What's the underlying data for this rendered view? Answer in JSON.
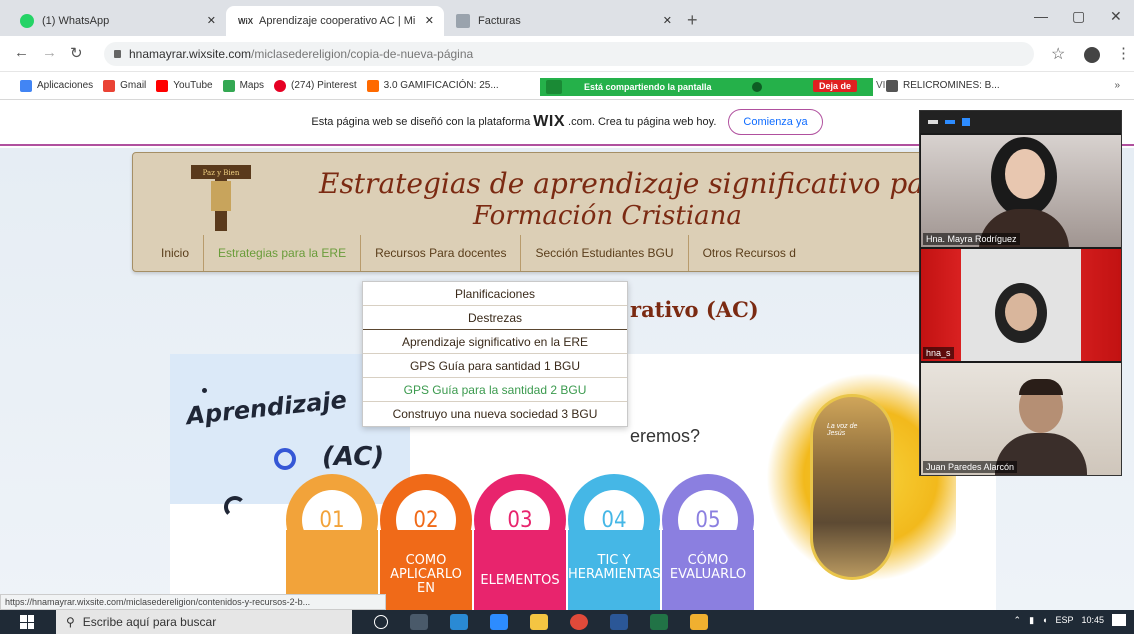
{
  "browser": {
    "tabs": [
      {
        "label": "(1) WhatsApp",
        "favicon_color": "#25d366"
      },
      {
        "label": "Aprendizaje cooperativo AC | Mi",
        "favicon_text": "WiX"
      },
      {
        "label": "Facturas"
      }
    ],
    "new_tab": "+",
    "url_host": "hnamayrar.wixsite.com",
    "url_path": "/miclasedereligion/copia-de-nueva-página",
    "bookmarks": [
      {
        "label": "Aplicaciones",
        "color": "#4285f4"
      },
      {
        "label": "Gmail",
        "color": "#ea4335"
      },
      {
        "label": "YouTube",
        "color": "#ff0000"
      },
      {
        "label": "Maps",
        "color": "#34a853"
      },
      {
        "label": "(274) Pinterest",
        "color": "#e60023"
      },
      {
        "label": "3.0 GAMIFICACIÓN: 25...",
        "color": "#ff6a00"
      }
    ],
    "bookmark_tail": "RELICROMINES: B...",
    "share_text": "Está compartiendo la pantalla",
    "share_stop": "Deja de",
    "share_overflow": "VI..."
  },
  "wix_banner": {
    "text_before": "Esta página web se diseñó con la plataforma",
    "logo": "WIX",
    "text_after": ".com. Crea tu página web hoy.",
    "cta": "Comienza ya"
  },
  "site": {
    "logo_text": "Paz y Bien",
    "title_line1": "Estrategias de aprendizaje significativo para",
    "title_line2": "Formación Cristiana",
    "nav": [
      "Inicio",
      "Estrategias para la ERE",
      "Recursos Para docentes",
      "Sección Estudiantes BGU",
      "Otros Recursos d"
    ],
    "dropdown": [
      "Planificaciones",
      "Destrezas",
      "Aprendizaje significativo en la ERE",
      "GPS Guía para santidad 1 BGU",
      "GPS Guía para la santidad 2 BGU",
      "Construyo una nueva sociedad 3 BGU"
    ],
    "subtitle": "rativo (AC)",
    "hero_title": "Aprendizaje",
    "hero_ac": "(AC)",
    "question": "eremos?",
    "book_title": "La voz de Jesús"
  },
  "steps": [
    {
      "num": "01",
      "label": "",
      "color": "#f2a33a"
    },
    {
      "num": "02",
      "label": "COMO APLICARLO EN",
      "color": "#f06a18"
    },
    {
      "num": "03",
      "label": "ELEMENTOS",
      "color": "#e8246d"
    },
    {
      "num": "04",
      "label": "TIC Y HERAMIENTAS",
      "color": "#45b7e6"
    },
    {
      "num": "05",
      "label": "CÓMO EVALUARLO",
      "color": "#8b7fe0"
    }
  ],
  "zoom": {
    "participants": [
      {
        "name": "Hna. Mayra Rodríguez"
      },
      {
        "name": "hna_s"
      },
      {
        "name": "Juan Paredes Alarcón"
      }
    ]
  },
  "status_url": "https://hnamayrar.wixsite.com/miclasedereligion/contenidos-y-recursos-2-b...",
  "taskbar": {
    "search_placeholder": "Escribe aquí para buscar",
    "lang": "ESP",
    "time": "10:45"
  }
}
